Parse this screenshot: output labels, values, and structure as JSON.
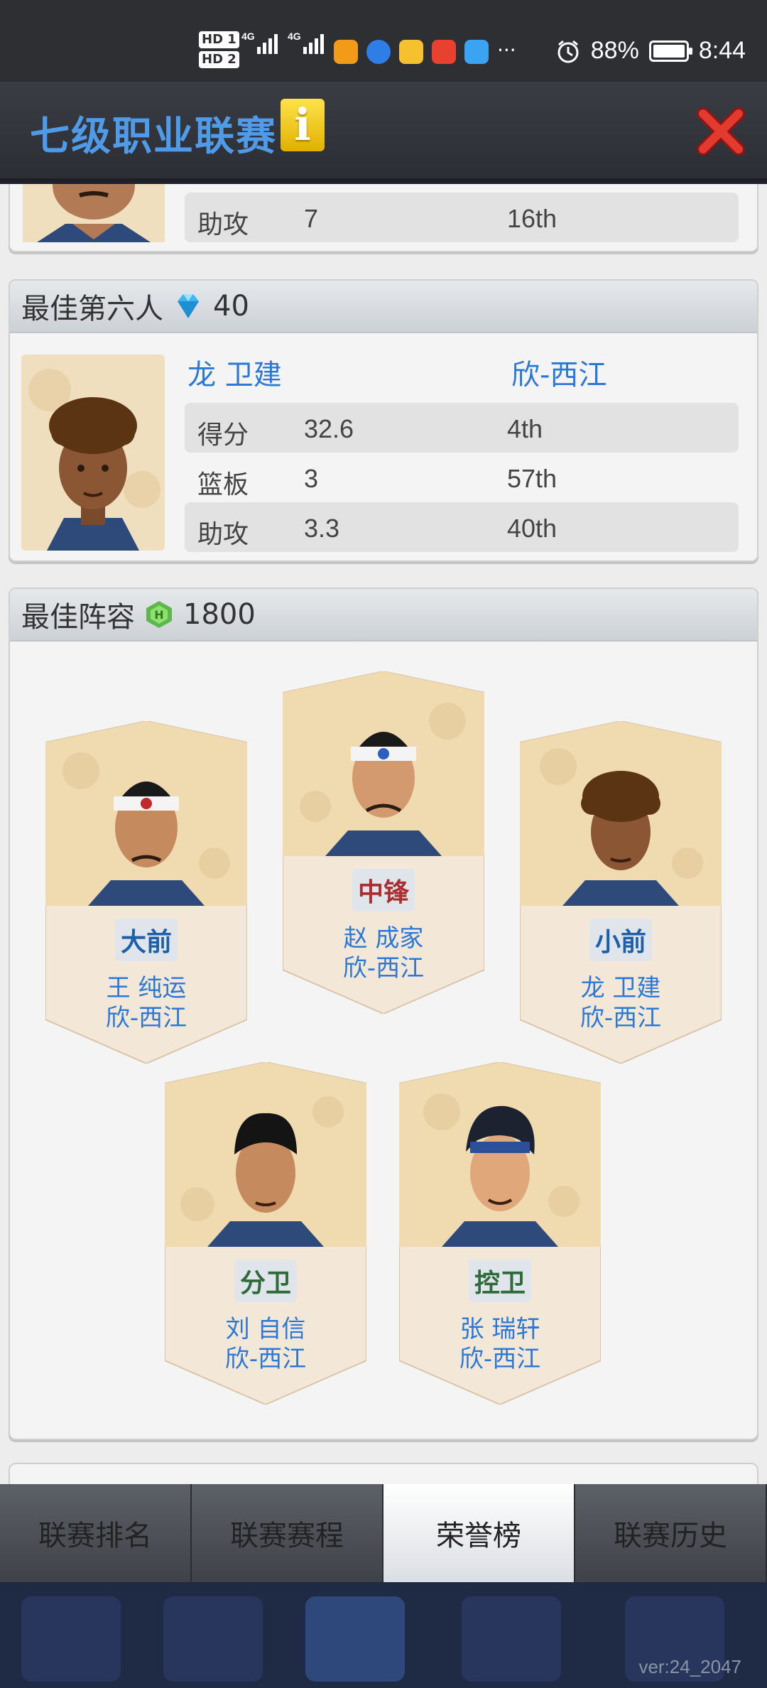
{
  "status": {
    "hd1": "HD 1",
    "hd2": "HD 2",
    "net1": "4G",
    "net2": "4G",
    "more": "···",
    "battery": "88%",
    "time": "8:44"
  },
  "header": {
    "title": "七级职业联赛",
    "info_label": "i"
  },
  "top_card": {
    "stat": {
      "label": "助攻",
      "value": "7",
      "rank": "16th"
    }
  },
  "sixth_man": {
    "title": "最佳第六人",
    "reward": "40",
    "player_name": "龙 卫建",
    "team": "欣-西江",
    "stats": [
      {
        "label": "得分",
        "value": "32.6",
        "rank": "4th"
      },
      {
        "label": "篮板",
        "value": "3",
        "rank": "57th"
      },
      {
        "label": "助攻",
        "value": "3.3",
        "rank": "40th"
      }
    ]
  },
  "best_lineup": {
    "title": "最佳阵容",
    "reward": "1800",
    "players": [
      {
        "position": "大前",
        "name": "王 纯运",
        "team": "欣-西江"
      },
      {
        "position": "中锋",
        "name": "赵 成家",
        "team": "欣-西江"
      },
      {
        "position": "小前",
        "name": "龙 卫建",
        "team": "欣-西江"
      },
      {
        "position": "分卫",
        "name": "刘 自信",
        "team": "欣-西江"
      },
      {
        "position": "控卫",
        "name": "张 瑞轩",
        "team": "欣-西江"
      }
    ]
  },
  "tabs": [
    {
      "label": "联赛排名"
    },
    {
      "label": "联赛赛程"
    },
    {
      "label": "荣誉榜"
    },
    {
      "label": "联赛历史"
    }
  ],
  "version": "ver:24_2047",
  "colors": {
    "accent": "#2b78d6",
    "title": "#4f9be8",
    "pos_blue": "#1d5fa8",
    "pos_red": "#a83030",
    "pos_green": "#2f6b3a"
  }
}
